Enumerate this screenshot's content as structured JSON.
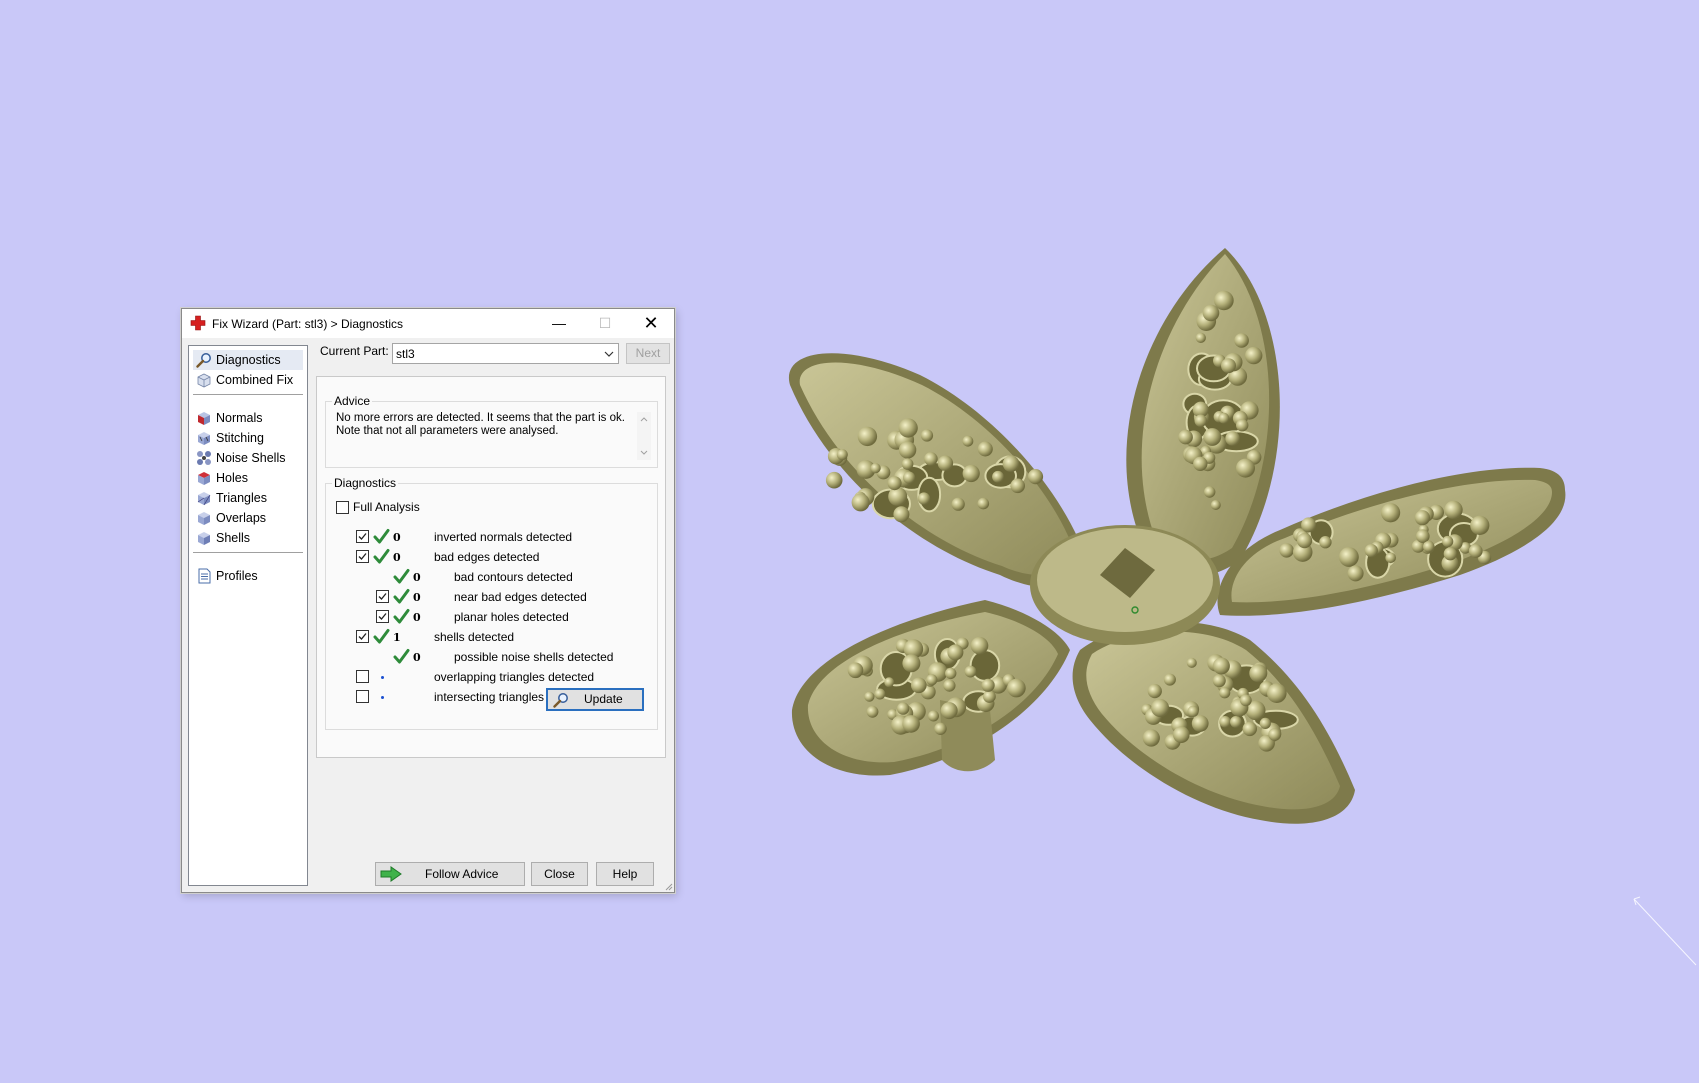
{
  "window": {
    "title": "Fix Wizard (Part: stl3) > Diagnostics",
    "minimize": "—",
    "maximize": "☐",
    "close": "✕"
  },
  "sidebar": {
    "items": [
      {
        "label": "Diagnostics",
        "icon": "magnifier-icon",
        "active": true
      },
      {
        "label": "Combined Fix",
        "icon": "combined-fix-icon"
      },
      {
        "label": "Normals",
        "icon": "normals-icon"
      },
      {
        "label": "Stitching",
        "icon": "stitching-icon"
      },
      {
        "label": "Noise Shells",
        "icon": "noise-shells-icon"
      },
      {
        "label": "Holes",
        "icon": "holes-icon"
      },
      {
        "label": "Triangles",
        "icon": "triangles-icon"
      },
      {
        "label": "Overlaps",
        "icon": "overlaps-icon"
      },
      {
        "label": "Shells",
        "icon": "shells-icon"
      },
      {
        "label": "Profiles",
        "icon": "profiles-icon"
      }
    ]
  },
  "part": {
    "label": "Current Part:",
    "value": "stl3",
    "next_label": "Next"
  },
  "advice": {
    "title": "Advice",
    "line1": "No more errors are detected. It seems that the part is ok.",
    "line2": "Note that not all parameters were analysed."
  },
  "diagnostics": {
    "title": "Diagnostics",
    "full_analysis_label": "Full Analysis",
    "full_analysis_checked": false,
    "rows": [
      {
        "count": "0",
        "label": "inverted normals detected",
        "checked": true,
        "status": "ok"
      },
      {
        "count": "0",
        "label": "bad edges detected",
        "checked": true,
        "status": "ok"
      },
      {
        "count": "0",
        "label": "bad contours detected",
        "status": "ok"
      },
      {
        "count": "0",
        "label": "near bad edges detected",
        "checked": true,
        "status": "ok"
      },
      {
        "count": "0",
        "label": "planar holes detected",
        "checked": true,
        "status": "ok"
      },
      {
        "count": "1",
        "label": "shells detected",
        "checked": true,
        "status": "ok"
      },
      {
        "count": "0",
        "label": "possible noise shells detected",
        "status": "ok"
      },
      {
        "count": "",
        "label": "overlapping triangles detected",
        "checked": false,
        "status": "not-run"
      },
      {
        "count": "",
        "label": "intersecting triangles detected",
        "checked": false,
        "status": "not-run"
      }
    ],
    "update_label": "Update"
  },
  "footer": {
    "follow_label": "Follow Advice",
    "close_label": "Close",
    "help_label": "Help"
  },
  "colors": {
    "background": "#c9c8f8",
    "model": "#b1ad78",
    "check_green": "#2e8b3a",
    "focus_blue": "#2a6fbf"
  }
}
